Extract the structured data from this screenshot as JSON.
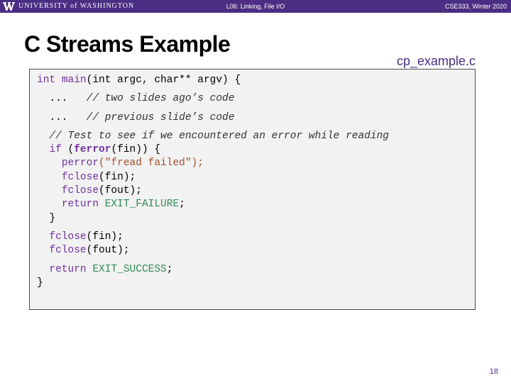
{
  "header": {
    "wordmark": "UNIVERSITY of WASHINGTON",
    "lecture": "L06: Linking, File I/O",
    "course": "CSE333, Winter 2020"
  },
  "slide": {
    "title": "C Streams Example",
    "filename": "cp_example.c",
    "page_number": "18"
  },
  "code": {
    "l1_type": "int",
    "l1_fn": "main",
    "l1_rest": "(int argc, char** argv) {",
    "l2_dots": "...",
    "l2_comment": "// two slides ago’s code",
    "l3_dots": "...",
    "l3_comment": "// previous slide’s code",
    "l4_comment": "// Test to see if we encountered an error while reading",
    "l5_if": "if",
    "l5_open": " (",
    "l5_fn": "ferror",
    "l5_rest": "(fin)) {",
    "l6_fn": "perror",
    "l6_str": "(\"fread failed\");",
    "l7_fn": "fclose",
    "l7_rest": "(fin);",
    "l8_fn": "fclose",
    "l8_rest": "(fout);",
    "l9_return": "return",
    "l9_macro": "EXIT_FAILURE",
    "l9_end": ";",
    "l10_close": "}",
    "l11_fn": "fclose",
    "l11_rest": "(fin);",
    "l12_fn": "fclose",
    "l12_rest": "(fout);",
    "l13_return": "return",
    "l13_macro": "EXIT_SUCCESS",
    "l13_end": ";",
    "l14_close": "}"
  }
}
